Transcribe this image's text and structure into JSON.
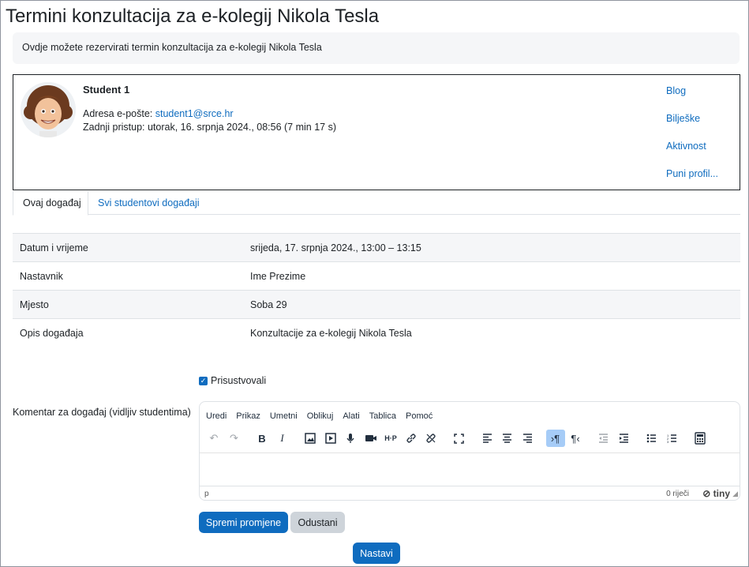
{
  "page": {
    "title": "Termini konzultacija za e-kolegij Nikola Tesla",
    "intro": "Ovdje možete rezervirati termin konzultacija za e-kolegij Nikola Tesla"
  },
  "user": {
    "name": "Student 1",
    "email_label": "Adresa e-pošte: ",
    "email": "student1@srce.hr",
    "last_access": "Zadnji pristup: utorak, 16. srpnja 2024., 08:56  (7 min 17 s)",
    "links": [
      "Blog",
      "Bilješke",
      "Aktivnost",
      "Puni profil..."
    ]
  },
  "tabs": [
    {
      "label": "Ovaj događaj",
      "active": true
    },
    {
      "label": "Svi studentovi događaji",
      "active": false
    }
  ],
  "details": [
    {
      "key": "Datum i vrijeme",
      "value": "srijeda, 17. srpnja 2024., 13:00 – 13:15"
    },
    {
      "key": "Nastavnik",
      "value": "Ime Prezime"
    },
    {
      "key": "Mjesto",
      "value": "Soba 29"
    },
    {
      "key": "Opis događaja",
      "value": "Konzultacije za e-kolegij Nikola Tesla"
    }
  ],
  "attended": {
    "label": "Prisustvovali",
    "checked": true
  },
  "comment": {
    "label": "Komentar za događaj (vidljiv studentima)",
    "menu": [
      "Uredi",
      "Prikaz",
      "Umetni",
      "Oblikuj",
      "Alati",
      "Tablica",
      "Pomoć"
    ],
    "status_path": "p",
    "word_count": "0 riječi",
    "brand": "tiny"
  },
  "buttons": {
    "save": "Spremi promjene",
    "cancel": "Odustani",
    "continue": "Nastavi"
  },
  "colors": {
    "accent": "#0f6cbf",
    "secondary_button": "#ced4da"
  }
}
